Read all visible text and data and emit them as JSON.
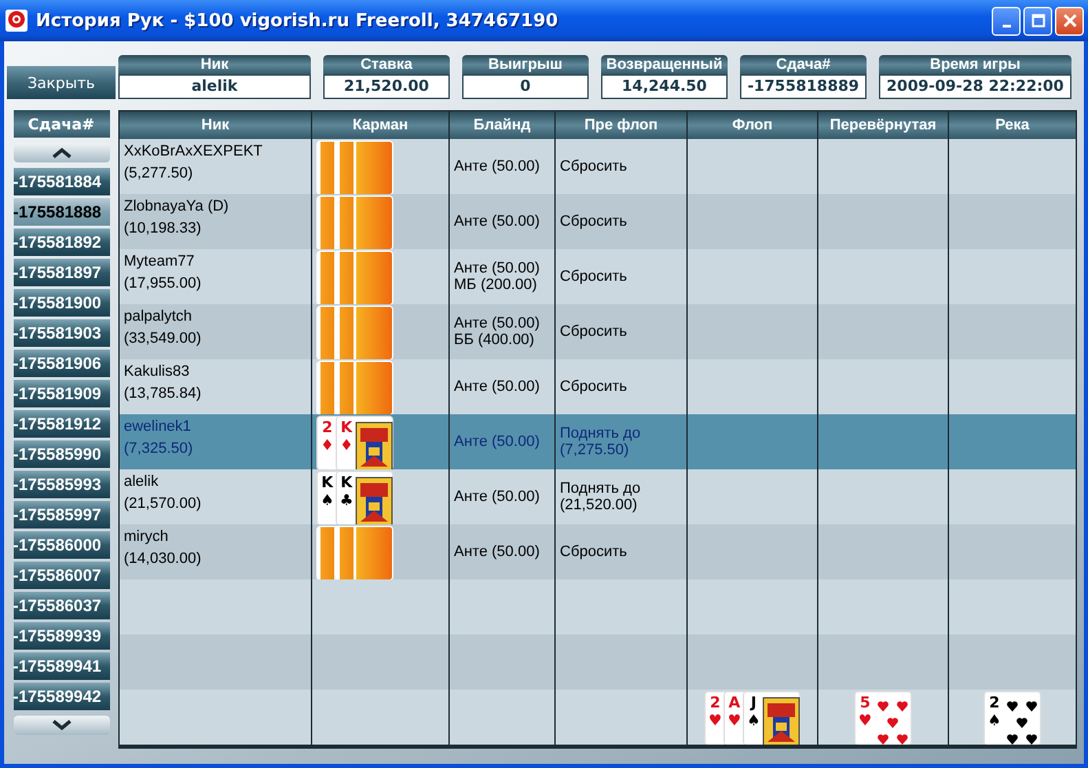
{
  "window": {
    "title": "История Рук - $100 vigorish.ru Freeroll, 347467190"
  },
  "close_button": "Закрыть",
  "summary": [
    {
      "label": "Ник",
      "value": "alelik",
      "kind": "wide"
    },
    {
      "label": "Ставка",
      "value": "21,520.00",
      "kind": "normal"
    },
    {
      "label": "Выигрыш",
      "value": "0",
      "kind": "normal"
    },
    {
      "label": "Возвращенный",
      "value": "14,244.50",
      "kind": "normal"
    },
    {
      "label": "Сдача#",
      "value": "-1755818889",
      "kind": "normal"
    },
    {
      "label": "Время игры",
      "value": "2009-09-28 22:22:00",
      "kind": "wide"
    }
  ],
  "hands": {
    "header": "Сдача#",
    "items": [
      {
        "label": "-175581884",
        "selected": false
      },
      {
        "label": "-175581888",
        "selected": true
      },
      {
        "label": "-175581892",
        "selected": false
      },
      {
        "label": "-175581897",
        "selected": false
      },
      {
        "label": "-175581900",
        "selected": false
      },
      {
        "label": "-175581903",
        "selected": false
      },
      {
        "label": "-175581906",
        "selected": false
      },
      {
        "label": "-175581909",
        "selected": false
      },
      {
        "label": "-175581912",
        "selected": false
      },
      {
        "label": "-175585990",
        "selected": false
      },
      {
        "label": "-175585993",
        "selected": false
      },
      {
        "label": "-175585997",
        "selected": false
      },
      {
        "label": "-175586000",
        "selected": false
      },
      {
        "label": "-175586007",
        "selected": false
      },
      {
        "label": "-175586037",
        "selected": false
      },
      {
        "label": "-175589939",
        "selected": false
      },
      {
        "label": "-175589941",
        "selected": false
      },
      {
        "label": "-175589942",
        "selected": false
      }
    ]
  },
  "table": {
    "columns": [
      "Ник",
      "Карман",
      "Блайнд",
      "Пре флоп",
      "Флоп",
      "Перевёрнутая",
      "Река"
    ],
    "rows": [
      {
        "player": "XxKoBrAxXEXPEKT",
        "stack": "(5,277.50)",
        "selected": false,
        "pocket": [
          {
            "kind": "back"
          },
          {
            "kind": "back"
          }
        ],
        "blind": [
          "Анте (50.00)"
        ],
        "preflop": [
          "Сбросить"
        ]
      },
      {
        "player": "ZlobnayaYa (D)",
        "stack": "(10,198.33)",
        "selected": false,
        "pocket": [
          {
            "kind": "back"
          },
          {
            "kind": "back"
          }
        ],
        "blind": [
          "Анте (50.00)"
        ],
        "preflop": [
          "Сбросить"
        ]
      },
      {
        "player": "Myteam77",
        "stack": "(17,955.00)",
        "selected": false,
        "pocket": [
          {
            "kind": "back"
          },
          {
            "kind": "back"
          }
        ],
        "blind": [
          "Анте (50.00)",
          "МБ (200.00)"
        ],
        "preflop": [
          "Сбросить"
        ]
      },
      {
        "player": "palpalytch",
        "stack": "(33,549.00)",
        "selected": false,
        "pocket": [
          {
            "kind": "back"
          },
          {
            "kind": "back"
          }
        ],
        "blind": [
          "Анте (50.00)",
          "ББ (400.00)"
        ],
        "preflop": [
          "Сбросить"
        ]
      },
      {
        "player": "Kakulis83",
        "stack": "(13,785.84)",
        "selected": false,
        "pocket": [
          {
            "kind": "back"
          },
          {
            "kind": "back"
          }
        ],
        "blind": [
          "Анте (50.00)"
        ],
        "preflop": [
          "Сбросить"
        ]
      },
      {
        "player": "ewelinek1",
        "stack": "(7,325.50)",
        "selected": true,
        "pocket": [
          {
            "kind": "pips",
            "rank": "2",
            "suit": "♦",
            "color": "#e0101c"
          },
          {
            "kind": "court",
            "rank": "K",
            "suit": "♦",
            "color": "#e0101c"
          }
        ],
        "blind": [
          "Анте (50.00)"
        ],
        "preflop": [
          "Поднять до",
          "(7,275.50)"
        ]
      },
      {
        "player": "alelik",
        "stack": "(21,570.00)",
        "selected": false,
        "pocket": [
          {
            "kind": "court",
            "rank": "K",
            "suit": "♠",
            "color": "#000000"
          },
          {
            "kind": "court",
            "rank": "K",
            "suit": "♣",
            "color": "#000000"
          }
        ],
        "blind": [
          "Анте (50.00)"
        ],
        "preflop": [
          "Поднять до",
          "(21,520.00)"
        ]
      },
      {
        "player": "mirych",
        "stack": "(14,030.00)",
        "selected": false,
        "pocket": [
          {
            "kind": "back"
          },
          {
            "kind": "back"
          }
        ],
        "blind": [
          "Анте (50.00)"
        ],
        "preflop": [
          "Сбросить"
        ]
      },
      {
        "selected": false
      },
      {
        "selected": false
      },
      {
        "selected": false,
        "flop": [
          {
            "kind": "pips",
            "rank": "2",
            "suit": "♥",
            "color": "#e0101c"
          },
          {
            "kind": "pips",
            "rank": "A",
            "suit": "♥",
            "color": "#e0101c"
          },
          {
            "kind": "court",
            "rank": "J",
            "suit": "♠",
            "color": "#000000"
          }
        ],
        "turn": [
          {
            "kind": "pips",
            "rank": "5",
            "suit": "♥",
            "color": "#e0101c"
          }
        ],
        "river": [
          {
            "kind": "pips",
            "rank": "2",
            "suit": "♠",
            "color": "#000000"
          }
        ]
      }
    ]
  }
}
